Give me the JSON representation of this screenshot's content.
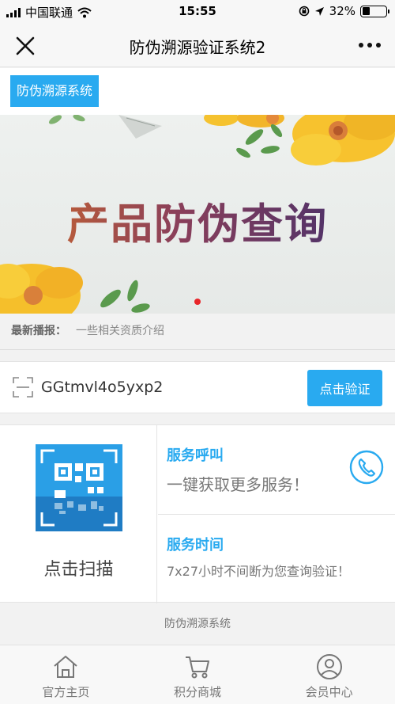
{
  "status_bar": {
    "carrier": "中国联通",
    "time": "15:55",
    "battery": "32%",
    "battery_level": 0.32
  },
  "nav": {
    "title": "防伪溯源验证系统2",
    "close_icon": "close-icon",
    "more_icon": "more-icon"
  },
  "brand": {
    "tag": "防伪溯源系统"
  },
  "banner": {
    "title": "产品防伪查询",
    "active_slide": 1,
    "slide_count": 1
  },
  "news": {
    "label": "最新播报：",
    "text": "一些相关资质介绍"
  },
  "code": {
    "value": "GGtmvl4o5yxp2",
    "verify_label": "点击验证"
  },
  "scan": {
    "label": "点击扫描"
  },
  "services": {
    "call_title": "服务呼叫",
    "call_desc": "一键获取更多服务！",
    "time_title": "服务时间",
    "time_desc": "7x27小时不间断为您查询验证！"
  },
  "footer": {
    "brand": "防伪溯源系统"
  },
  "tabs": [
    {
      "label": "官方主页",
      "icon": "home-icon"
    },
    {
      "label": "积分商城",
      "icon": "cart-icon"
    },
    {
      "label": "会员中心",
      "icon": "user-icon"
    }
  ],
  "colors": {
    "accent": "#29aaf0",
    "dot_active": "#e8262a"
  }
}
